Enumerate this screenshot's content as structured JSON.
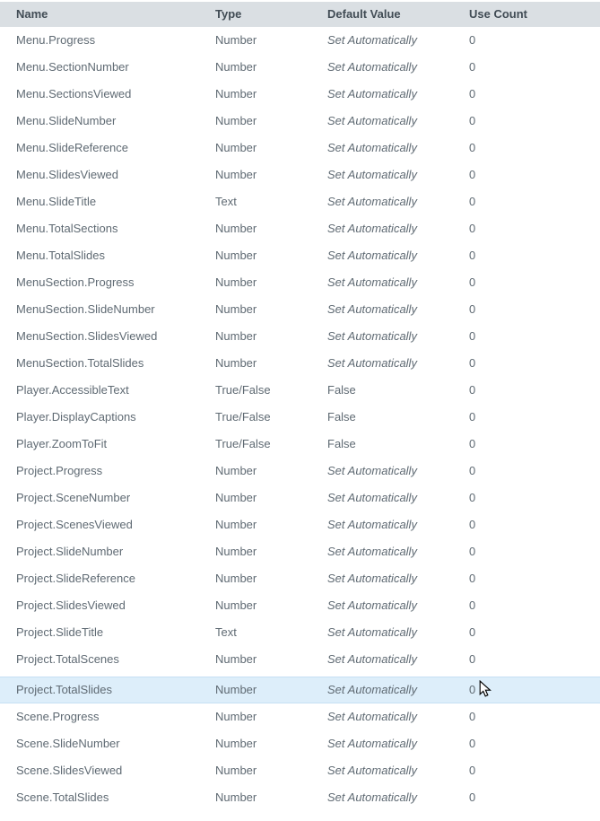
{
  "table": {
    "columns": [
      {
        "label": "Name"
      },
      {
        "label": "Type"
      },
      {
        "label": "Default Value"
      },
      {
        "label": "Use Count"
      }
    ],
    "rows": [
      {
        "name": "Menu.Progress",
        "type": "Number",
        "default_value": "Set Automatically",
        "use_count": "0",
        "auto_default": true,
        "selected": false
      },
      {
        "name": "Menu.SectionNumber",
        "type": "Number",
        "default_value": "Set Automatically",
        "use_count": "0",
        "auto_default": true,
        "selected": false
      },
      {
        "name": "Menu.SectionsViewed",
        "type": "Number",
        "default_value": "Set Automatically",
        "use_count": "0",
        "auto_default": true,
        "selected": false
      },
      {
        "name": "Menu.SlideNumber",
        "type": "Number",
        "default_value": "Set Automatically",
        "use_count": "0",
        "auto_default": true,
        "selected": false
      },
      {
        "name": "Menu.SlideReference",
        "type": "Number",
        "default_value": "Set Automatically",
        "use_count": "0",
        "auto_default": true,
        "selected": false
      },
      {
        "name": "Menu.SlidesViewed",
        "type": "Number",
        "default_value": "Set Automatically",
        "use_count": "0",
        "auto_default": true,
        "selected": false
      },
      {
        "name": "Menu.SlideTitle",
        "type": "Text",
        "default_value": "Set Automatically",
        "use_count": "0",
        "auto_default": true,
        "selected": false
      },
      {
        "name": "Menu.TotalSections",
        "type": "Number",
        "default_value": "Set Automatically",
        "use_count": "0",
        "auto_default": true,
        "selected": false
      },
      {
        "name": "Menu.TotalSlides",
        "type": "Number",
        "default_value": "Set Automatically",
        "use_count": "0",
        "auto_default": true,
        "selected": false
      },
      {
        "name": "MenuSection.Progress",
        "type": "Number",
        "default_value": "Set Automatically",
        "use_count": "0",
        "auto_default": true,
        "selected": false
      },
      {
        "name": "MenuSection.SlideNumber",
        "type": "Number",
        "default_value": "Set Automatically",
        "use_count": "0",
        "auto_default": true,
        "selected": false
      },
      {
        "name": "MenuSection.SlidesViewed",
        "type": "Number",
        "default_value": "Set Automatically",
        "use_count": "0",
        "auto_default": true,
        "selected": false
      },
      {
        "name": "MenuSection.TotalSlides",
        "type": "Number",
        "default_value": "Set Automatically",
        "use_count": "0",
        "auto_default": true,
        "selected": false
      },
      {
        "name": "Player.AccessibleText",
        "type": "True/False",
        "default_value": "False",
        "use_count": "0",
        "auto_default": false,
        "selected": false
      },
      {
        "name": "Player.DisplayCaptions",
        "type": "True/False",
        "default_value": "False",
        "use_count": "0",
        "auto_default": false,
        "selected": false
      },
      {
        "name": "Player.ZoomToFit",
        "type": "True/False",
        "default_value": "False",
        "use_count": "0",
        "auto_default": false,
        "selected": false
      },
      {
        "name": "Project.Progress",
        "type": "Number",
        "default_value": "Set Automatically",
        "use_count": "0",
        "auto_default": true,
        "selected": false
      },
      {
        "name": "Project.SceneNumber",
        "type": "Number",
        "default_value": "Set Automatically",
        "use_count": "0",
        "auto_default": true,
        "selected": false
      },
      {
        "name": "Project.ScenesViewed",
        "type": "Number",
        "default_value": "Set Automatically",
        "use_count": "0",
        "auto_default": true,
        "selected": false
      },
      {
        "name": "Project.SlideNumber",
        "type": "Number",
        "default_value": "Set Automatically",
        "use_count": "0",
        "auto_default": true,
        "selected": false
      },
      {
        "name": "Project.SlideReference",
        "type": "Number",
        "default_value": "Set Automatically",
        "use_count": "0",
        "auto_default": true,
        "selected": false
      },
      {
        "name": "Project.SlidesViewed",
        "type": "Number",
        "default_value": "Set Automatically",
        "use_count": "0",
        "auto_default": true,
        "selected": false
      },
      {
        "name": "Project.SlideTitle",
        "type": "Text",
        "default_value": "Set Automatically",
        "use_count": "0",
        "auto_default": true,
        "selected": false
      },
      {
        "name": "Project.TotalScenes",
        "type": "Number",
        "default_value": "Set Automatically",
        "use_count": "0",
        "auto_default": true,
        "selected": false
      },
      {
        "name": "Project.TotalSlides",
        "type": "Number",
        "default_value": "Set Automatically",
        "use_count": "0",
        "auto_default": true,
        "selected": true
      },
      {
        "name": "Scene.Progress",
        "type": "Number",
        "default_value": "Set Automatically",
        "use_count": "0",
        "auto_default": true,
        "selected": false
      },
      {
        "name": "Scene.SlideNumber",
        "type": "Number",
        "default_value": "Set Automatically",
        "use_count": "0",
        "auto_default": true,
        "selected": false
      },
      {
        "name": "Scene.SlidesViewed",
        "type": "Number",
        "default_value": "Set Automatically",
        "use_count": "0",
        "auto_default": true,
        "selected": false
      },
      {
        "name": "Scene.TotalSlides",
        "type": "Number",
        "default_value": "Set Automatically",
        "use_count": "0",
        "auto_default": true,
        "selected": false
      }
    ]
  },
  "cursor": {
    "icon": "arrow-cursor-icon"
  },
  "colors": {
    "header_bg": "#dadfe3",
    "header_text": "#414c55",
    "row_text": "#5f6a73",
    "selected_bg": "#ddeefa",
    "selected_border": "#c5dff4",
    "page_bg": "#ffffff"
  }
}
